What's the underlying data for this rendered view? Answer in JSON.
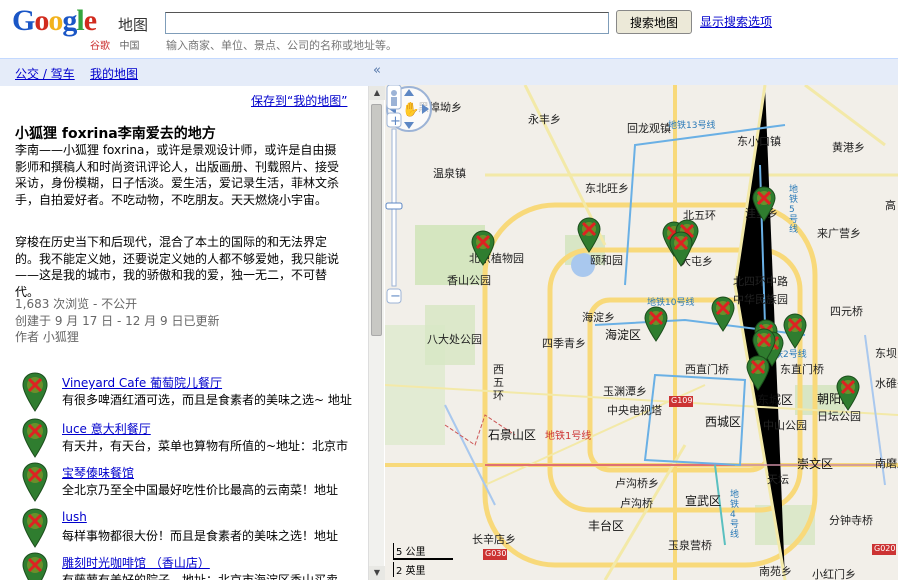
{
  "header": {
    "logo_word": "Google",
    "logo_product": "地图",
    "logo_sub_cn": "谷歌",
    "logo_sub_region": "中国",
    "search_value": "",
    "search_button": "搜索地图",
    "search_options": "显示搜索选项",
    "search_hint": "输入商家、单位、景点、公司的名称或地址等。"
  },
  "sidebar": {
    "link_transit": "公交 / 驾车",
    "link_mymaps": "我的地图",
    "collapse": "«",
    "save_link": "保存到“我的地图”",
    "title": "小狐狸  foxrina李南爱去的地方",
    "desc1": "李南——小狐狸 foxrina，或许是景观设计师，或许是自由摄影师和撰稿人和时尚资讯评论人，出版画册、刊载照片、接受采访，身份模糊，日子恬淡。爱生活，爱记录生活，菲林文杀手，自拍爱好者。不吃动物，不吃朋友。天天燃烧小宇宙。",
    "desc2": "穿梭在历史当下和后现代，混合了本土的国际的和无法界定的。我不能定义她，还要说定义她的人都不够爱她，我只能说——这是我的城市，我的骄傲和我的爱，独一无二，不可替代。",
    "views": "1,683 次浏览 - 不公开",
    "created": "创建于 9 月 17 日 - 12 月 9 日已更新",
    "author": "作者  小狐狸",
    "places": [
      {
        "name": "Vineyard Cafe 葡萄院儿餐厅",
        "snippet": "有很多啤酒红酒可选，而且是食素者的美味之选~ 地址"
      },
      {
        "name": "luce 意大利餐厅",
        "snippet": "有天井，有天台，菜单也算物有所值的~地址：北京市"
      },
      {
        "name": "宝琴傣味餐馆",
        "snippet": "全北京乃至全中国最好吃性价比最高的云南菜！地址"
      },
      {
        "name": "lush",
        "snippet": "每样事物都很大份！而且是食素者的美味之选！地址"
      },
      {
        "name": "雕刻时光咖啡馆 （香山店）",
        "snippet": "有藤萝有美好的院子，地址：北京市海淀区香山买卖"
      }
    ]
  },
  "map": {
    "labels": [
      {
        "t": "黑埠坳乡",
        "c": "plabel"
      },
      {
        "t": "永丰乡",
        "c": "plabel"
      },
      {
        "t": "回龙观镇",
        "c": "plabel"
      },
      {
        "t": "东小口镇",
        "c": "plabel"
      },
      {
        "t": "黄港乡",
        "c": "plabel"
      },
      {
        "t": "温泉镇",
        "c": "plabel"
      },
      {
        "t": "东北旺乡",
        "c": "plabel"
      },
      {
        "t": "北五环",
        "c": "plabel"
      },
      {
        "t": "洼里乡",
        "c": "plabel"
      },
      {
        "t": "来广营乡",
        "c": "plabel"
      },
      {
        "t": "北京植物园",
        "c": "plabel"
      },
      {
        "t": "颐和园",
        "c": "plabel"
      },
      {
        "t": "大屯乡",
        "c": "plabel"
      },
      {
        "t": "香山公园",
        "c": "plabel"
      },
      {
        "t": "海淀乡",
        "c": "plabel"
      },
      {
        "t": "北四环中路",
        "c": "plabel"
      },
      {
        "t": "中华民族园",
        "c": "plabel"
      },
      {
        "t": "四元桥",
        "c": "plabel"
      },
      {
        "t": "海淀区",
        "c": "plabel big"
      },
      {
        "t": "八大处公园",
        "c": "plabel"
      },
      {
        "t": "四季青乡",
        "c": "plabel"
      },
      {
        "t": "西直门桥",
        "c": "plabel"
      },
      {
        "t": "东直门桥",
        "c": "plabel"
      },
      {
        "t": "朝阳区",
        "c": "plabel big"
      },
      {
        "t": "西五环",
        "c": "plabel"
      },
      {
        "t": "玉渊潭乡",
        "c": "plabel"
      },
      {
        "t": "中央电视塔",
        "c": "plabel"
      },
      {
        "t": "东城区",
        "c": "plabel big"
      },
      {
        "t": "日坛公园",
        "c": "plabel"
      },
      {
        "t": "石景山区",
        "c": "plabel big"
      },
      {
        "t": "地铁1号线",
        "c": "plabel"
      },
      {
        "t": "西城区",
        "c": "plabel big"
      },
      {
        "t": "中山公园",
        "c": "plabel"
      },
      {
        "t": "崇文区",
        "c": "plabel big"
      },
      {
        "t": "卢沟桥乡",
        "c": "plabel"
      },
      {
        "t": "卢沟桥",
        "c": "plabel"
      },
      {
        "t": "宣武区",
        "c": "plabel big"
      },
      {
        "t": "天坛",
        "c": "plabel"
      },
      {
        "t": "丰台区",
        "c": "plabel big"
      },
      {
        "t": "分钟寺桥",
        "c": "plabel"
      },
      {
        "t": "长辛店乡",
        "c": "plabel"
      },
      {
        "t": "玉泉营桥",
        "c": "plabel"
      },
      {
        "t": "南苑乡",
        "c": "plabel"
      },
      {
        "t": "小红门乡",
        "c": "plabel"
      },
      {
        "t": "高",
        "c": "plabel"
      },
      {
        "t": "东坝乡",
        "c": "plabel"
      },
      {
        "t": "水碓子",
        "c": "plabel"
      },
      {
        "t": "南磨房",
        "c": "plabel"
      }
    ],
    "road_labels": [
      "G109",
      "G020",
      "G030"
    ],
    "scale_km": "5 公里",
    "scale_mi": "2 英里",
    "metro_labels": [
      "地铁13号线",
      "地铁10号线",
      "地铁5号线",
      "地铁2号线",
      "地铁4号线"
    ]
  },
  "colors": {
    "link": "#0000cc",
    "topbar": "#e5ecf9",
    "marker_green": "#2f7d2f",
    "marker_red": "#d22"
  }
}
